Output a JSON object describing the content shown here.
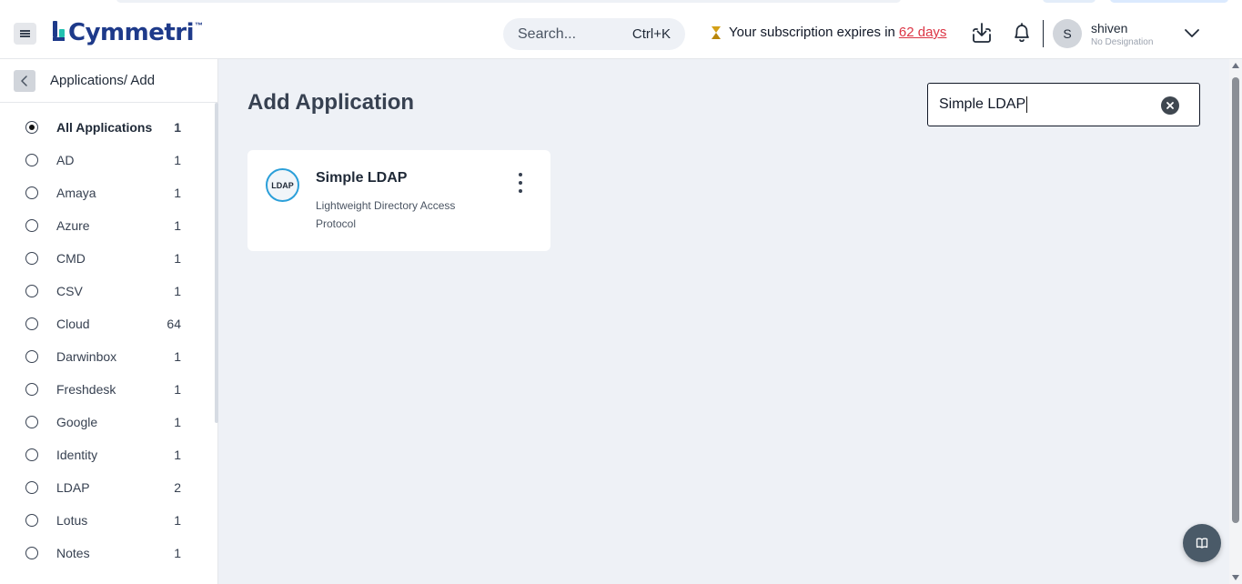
{
  "header": {
    "brand": "Cymmetri",
    "brand_tm": "™",
    "search_placeholder": "Search...",
    "search_shortcut": "Ctrl+K",
    "subscription_text": "Your subscription expires in",
    "subscription_days": "62 days",
    "user": {
      "initial": "S",
      "name": "shiven",
      "designation": "No Designation"
    }
  },
  "sidebar": {
    "title": "Applications/ Add",
    "categories": [
      {
        "label": "All Applications",
        "count": "1",
        "selected": true
      },
      {
        "label": "AD",
        "count": "1"
      },
      {
        "label": "Amaya",
        "count": "1"
      },
      {
        "label": "Azure",
        "count": "1"
      },
      {
        "label": "CMD",
        "count": "1"
      },
      {
        "label": "CSV",
        "count": "1"
      },
      {
        "label": "Cloud",
        "count": "64"
      },
      {
        "label": "Darwinbox",
        "count": "1"
      },
      {
        "label": "Freshdesk",
        "count": "1"
      },
      {
        "label": "Google",
        "count": "1"
      },
      {
        "label": "Identity",
        "count": "1"
      },
      {
        "label": "LDAP",
        "count": "2"
      },
      {
        "label": "Lotus",
        "count": "1"
      },
      {
        "label": "Notes",
        "count": "1"
      }
    ]
  },
  "main": {
    "title": "Add Application",
    "filter_value": "Simple LDAP",
    "cards": [
      {
        "logo_text": "LDAP",
        "title": "Simple LDAP",
        "description": "Lightweight Directory Access Protocol"
      }
    ]
  },
  "colors": {
    "brand": "#1e3a8a",
    "brand_accent": "#22c1b0",
    "days_link": "#dc3545",
    "background": "#eef1f6",
    "ldap_ring": "#2b9fd9"
  }
}
